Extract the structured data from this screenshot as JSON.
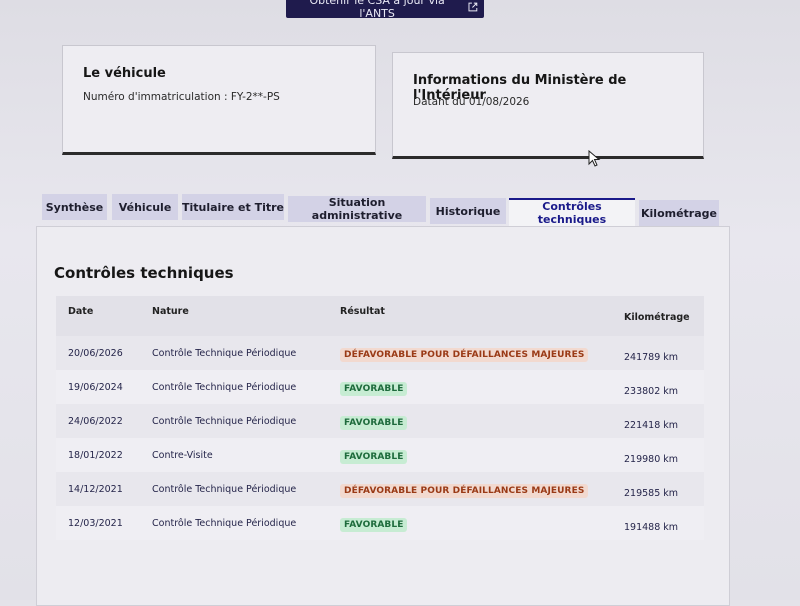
{
  "top_button": {
    "label": "Obtenir le CSA à jour via l'ANTS",
    "icon": "external-link-icon"
  },
  "vehicle_card": {
    "title": "Le véhicule",
    "registration": "Numéro d'immatriculation : FY-2**-PS"
  },
  "ministry_card": {
    "title": "Informations du Ministère de l'Intérieur",
    "date": "Datant du 01/08/2026"
  },
  "tabs": [
    {
      "label": "Synthèse",
      "active": false
    },
    {
      "label": "Véhicule",
      "active": false
    },
    {
      "label": "Titulaire et Titre",
      "active": false
    },
    {
      "label": "Situation administrative",
      "active": false
    },
    {
      "label": "Historique",
      "active": false
    },
    {
      "label": "Contrôles techniques",
      "active": true
    },
    {
      "label": "Kilométrage",
      "active": false
    }
  ],
  "section_title": "Contrôles techniques",
  "table": {
    "headers": {
      "date": "Date",
      "nature": "Nature",
      "result": "Résultat",
      "mileage": "Kilométrage"
    },
    "rows": [
      {
        "date": "20/06/2026",
        "nature": "Contrôle Technique Périodique",
        "result": "DÉFAVORABLE POUR DÉFAILLANCES MAJEURES",
        "status": "unfavorable",
        "mileage": "241789 km"
      },
      {
        "date": "19/06/2024",
        "nature": "Contrôle Technique Périodique",
        "result": "FAVORABLE",
        "status": "favorable",
        "mileage": "233802 km"
      },
      {
        "date": "24/06/2022",
        "nature": "Contrôle Technique Périodique",
        "result": "FAVORABLE",
        "status": "favorable",
        "mileage": "221418 km"
      },
      {
        "date": "18/01/2022",
        "nature": "Contre-Visite",
        "result": "FAVORABLE",
        "status": "favorable",
        "mileage": "219980 km"
      },
      {
        "date": "14/12/2021",
        "nature": "Contrôle Technique Périodique",
        "result": "DÉFAVORABLE POUR DÉFAILLANCES MAJEURES",
        "status": "unfavorable",
        "mileage": "219585 km"
      },
      {
        "date": "12/03/2021",
        "nature": "Contrôle Technique Périodique",
        "result": "FAVORABLE",
        "status": "favorable",
        "mileage": "191488 km"
      }
    ]
  },
  "colors": {
    "primary": "#1f1b4d",
    "active_tab": "#1a1a8a",
    "favorable_bg": "#c7ecd3",
    "favorable_text": "#1e6b3c",
    "unfavorable_bg": "#f2d9cf",
    "unfavorable_text": "#9a3a16"
  }
}
